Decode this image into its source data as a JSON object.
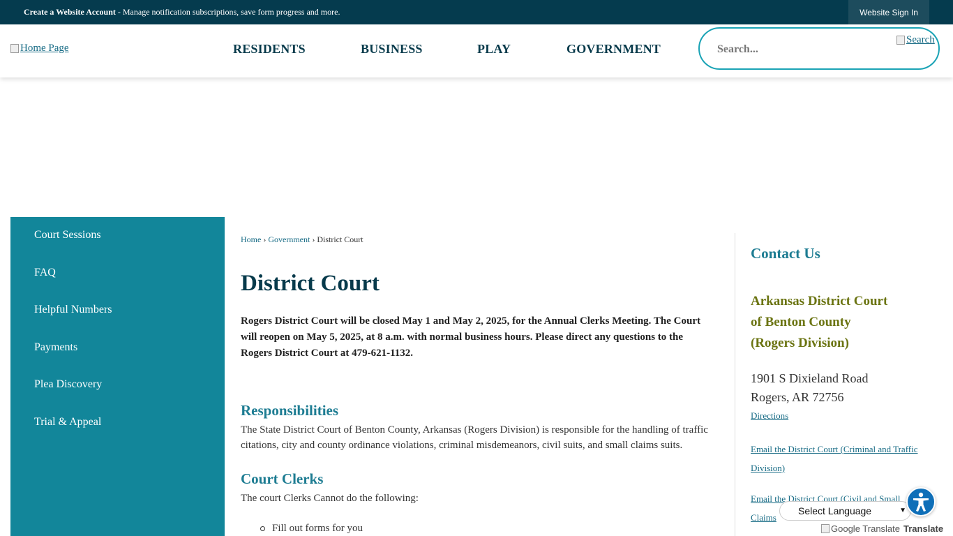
{
  "topbar": {
    "account_link": "Create a Website Account",
    "account_desc": " - Manage notification subscriptions, save form progress and more.",
    "signin_label": "Website Sign In"
  },
  "header": {
    "home_link_alt": "Home Page",
    "nav": [
      "RESIDENTS",
      "BUSINESS",
      "PLAY",
      "GOVERNMENT"
    ],
    "search_placeholder": "Search...",
    "search_button_alt": "Search"
  },
  "sidebar": {
    "items": [
      "Court Sessions",
      "FAQ",
      "Helpful Numbers",
      "Payments",
      "Plea Discovery",
      "Trial & Appeal"
    ]
  },
  "breadcrumb": {
    "home": "Home",
    "government": "Government",
    "current": "District Court",
    "separator": "›"
  },
  "main": {
    "title": "District Court",
    "notice": "Rogers District Court will be closed May 1 and May 2, 2025, for the Annual Clerks Meeting. The Court will reopen on May 5, 2025, at 8 a.m. with normal business hours. Please direct any questions to the Rogers District Court at 479-621-1132.",
    "responsibilities_heading": "Responsibilities",
    "responsibilities_text": "The State District Court of Benton County, Arkansas (Rogers Division) is responsible for the handling of traffic citations, city and county ordinance violations, criminal misdemeanors, civil suits, and small claims suits.",
    "clerks_heading": "Court Clerks",
    "clerks_text": "The court Clerks Cannot do the following:",
    "clerks_list": [
      "Fill out forms for you"
    ]
  },
  "contact": {
    "heading": "Contact Us",
    "court_line1": "Arkansas District Court",
    "court_line2": "of Benton County",
    "court_line3": "(Rogers Division)",
    "address_line1": "1901 S Dixieland Road",
    "address_line2": "Rogers, AR 72756",
    "directions": "Directions",
    "email_criminal_1": "Email the District Court (Criminal and Traffic",
    "email_criminal_2": "Division)",
    "email_civil_1": "Email the District Court (Civil and Small",
    "email_civil_2": "Claims"
  },
  "widgets": {
    "language_select": "Select Language",
    "google_translate_alt": "Google Translate",
    "translate_label": "Translate"
  },
  "colors": {
    "topbar": "#053b4e",
    "sidebar": "#12869a",
    "heading": "#073a4b",
    "accent": "#1d7c92",
    "court_name": "#6b7412",
    "search_border": "#1aa3b5"
  },
  "icons": [
    "broken-image-icon",
    "accessibility-icon",
    "chevron-down-icon"
  ]
}
